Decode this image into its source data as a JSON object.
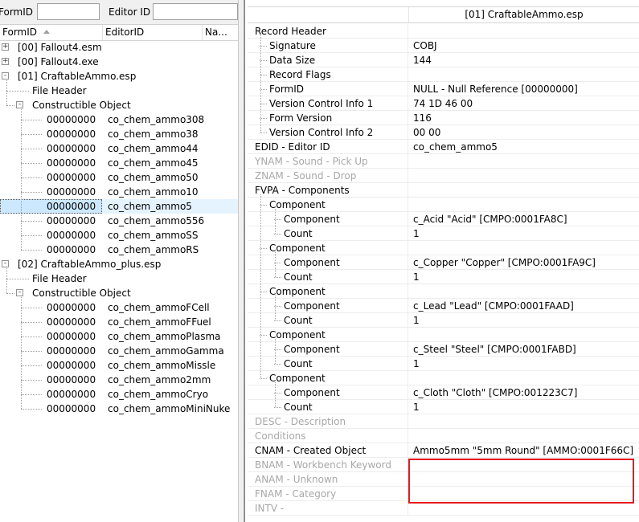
{
  "filters": {
    "formid_label": "FormID",
    "editorid_label": "Editor ID",
    "formid_value": "",
    "editorid_value": ""
  },
  "left_columns": {
    "formid": "FormID",
    "editorid": "EditorID",
    "name": "Na..."
  },
  "tree": [
    {
      "id": "t0",
      "level": 0,
      "expander": "+",
      "text": "[00] Fallout4.esm"
    },
    {
      "id": "t1",
      "level": 0,
      "expander": "+",
      "text": "[00] Fallout4.exe"
    },
    {
      "id": "t2",
      "level": 0,
      "expander": "-",
      "text": "[01] CraftableAmmo.esp"
    },
    {
      "id": "t3",
      "level": 1,
      "expander": "",
      "text": "File Header"
    },
    {
      "id": "t4",
      "level": 1,
      "expander": "-",
      "text": "Constructible Object"
    },
    {
      "id": "t5",
      "level": 2,
      "formid": "00000000",
      "editor": "co_chem_ammo308"
    },
    {
      "id": "t6",
      "level": 2,
      "formid": "00000000",
      "editor": "co_chem_ammo38"
    },
    {
      "id": "t7",
      "level": 2,
      "formid": "00000000",
      "editor": "co_chem_ammo44"
    },
    {
      "id": "t8",
      "level": 2,
      "formid": "00000000",
      "editor": "co_chem_ammo45"
    },
    {
      "id": "t9",
      "level": 2,
      "formid": "00000000",
      "editor": "co_chem_ammo50"
    },
    {
      "id": "t10",
      "level": 2,
      "formid": "00000000",
      "editor": "co_chem_ammo10"
    },
    {
      "id": "t11",
      "level": 2,
      "formid": "00000000",
      "editor": "co_chem_ammo5",
      "selected": true
    },
    {
      "id": "t12",
      "level": 2,
      "formid": "00000000",
      "editor": "co_chem_ammo556"
    },
    {
      "id": "t13",
      "level": 2,
      "formid": "00000000",
      "editor": "co_chem_ammoSS"
    },
    {
      "id": "t14",
      "level": 2,
      "formid": "00000000",
      "editor": "co_chem_ammoRS"
    },
    {
      "id": "t15",
      "level": 0,
      "expander": "-",
      "text": "[02] CraftableAmmo_plus.esp"
    },
    {
      "id": "t16",
      "level": 1,
      "expander": "",
      "text": "File Header"
    },
    {
      "id": "t17",
      "level": 1,
      "expander": "-",
      "text": "Constructible Object"
    },
    {
      "id": "t18",
      "level": 2,
      "formid": "00000000",
      "editor": "co_chem_ammoFCell"
    },
    {
      "id": "t19",
      "level": 2,
      "formid": "00000000",
      "editor": "co_chem_ammoFFuel"
    },
    {
      "id": "t20",
      "level": 2,
      "formid": "00000000",
      "editor": "co_chem_ammoPlasma"
    },
    {
      "id": "t21",
      "level": 2,
      "formid": "00000000",
      "editor": "co_chem_ammoGamma"
    },
    {
      "id": "t22",
      "level": 2,
      "formid": "00000000",
      "editor": "co_chem_ammoMissle"
    },
    {
      "id": "t23",
      "level": 2,
      "formid": "00000000",
      "editor": "co_chem_ammo2mm"
    },
    {
      "id": "t24",
      "level": 2,
      "formid": "00000000",
      "editor": "co_chem_ammoCryo"
    },
    {
      "id": "t25",
      "level": 2,
      "formid": "00000000",
      "editor": "co_chem_ammoMiniNuke"
    }
  ],
  "record_view": {
    "header_title": "[01] CraftableAmmo.esp",
    "rows": [
      {
        "label": "Record Header",
        "value": "",
        "level": 0,
        "grey": false
      },
      {
        "label": "Signature",
        "value": "COBJ",
        "level": 1,
        "grey": false
      },
      {
        "label": "Data Size",
        "value": "144",
        "level": 1,
        "grey": false
      },
      {
        "label": "Record Flags",
        "value": "",
        "level": 1,
        "grey": false
      },
      {
        "label": "FormID",
        "value": "NULL - Null Reference [00000000]",
        "level": 1,
        "grey": false
      },
      {
        "label": "Version Control Info 1",
        "value": "74 1D 46 00",
        "level": 1,
        "grey": false
      },
      {
        "label": "Form Version",
        "value": "116",
        "level": 1,
        "grey": false
      },
      {
        "label": "Version Control Info 2",
        "value": "00 00",
        "level": 1,
        "grey": false
      },
      {
        "label": "EDID - Editor ID",
        "value": "co_chem_ammo5",
        "level": 0,
        "grey": false
      },
      {
        "label": "YNAM - Sound - Pick Up",
        "value": "",
        "level": 0,
        "grey": true
      },
      {
        "label": "ZNAM - Sound - Drop",
        "value": "",
        "level": 0,
        "grey": true
      },
      {
        "label": "FVPA - Components",
        "value": "",
        "level": 0,
        "grey": false
      },
      {
        "label": "Component",
        "value": "",
        "level": 1,
        "grey": false
      },
      {
        "label": "Component",
        "value": "c_Acid \"Acid\" [CMPO:0001FA8C]",
        "level": 2,
        "grey": false
      },
      {
        "label": "Count",
        "value": "1",
        "level": 2,
        "grey": false
      },
      {
        "label": "Component",
        "value": "",
        "level": 1,
        "grey": false
      },
      {
        "label": "Component",
        "value": "c_Copper \"Copper\" [CMPO:0001FA9C]",
        "level": 2,
        "grey": false
      },
      {
        "label": "Count",
        "value": "1",
        "level": 2,
        "grey": false
      },
      {
        "label": "Component",
        "value": "",
        "level": 1,
        "grey": false
      },
      {
        "label": "Component",
        "value": "c_Lead \"Lead\" [CMPO:0001FAAD]",
        "level": 2,
        "grey": false
      },
      {
        "label": "Count",
        "value": "1",
        "level": 2,
        "grey": false
      },
      {
        "label": "Component",
        "value": "",
        "level": 1,
        "grey": false
      },
      {
        "label": "Component",
        "value": "c_Steel \"Steel\" [CMPO:0001FABD]",
        "level": 2,
        "grey": false
      },
      {
        "label": "Count",
        "value": "1",
        "level": 2,
        "grey": false
      },
      {
        "label": "Component",
        "value": "",
        "level": 1,
        "grey": false
      },
      {
        "label": "Component",
        "value": "c_Cloth \"Cloth\" [CMPO:001223C7]",
        "level": 2,
        "grey": false
      },
      {
        "label": "Count",
        "value": "1",
        "level": 2,
        "grey": false
      },
      {
        "label": "DESC - Description",
        "value": "",
        "level": 0,
        "grey": true
      },
      {
        "label": "Conditions",
        "value": "",
        "level": 0,
        "grey": true
      },
      {
        "label": "CNAM - Created Object",
        "value": "Ammo5mm \"5mm Round\" [AMMO:0001F66C]",
        "level": 0,
        "grey": false
      },
      {
        "label": "BNAM - Workbench Keyword",
        "value": "",
        "level": 0,
        "grey": true
      },
      {
        "label": "ANAM - Unknown",
        "value": "",
        "level": 0,
        "grey": true
      },
      {
        "label": "FNAM - Category",
        "value": "",
        "level": 0,
        "grey": true
      },
      {
        "label": "INTV -",
        "value": "",
        "level": 0,
        "grey": true
      }
    ]
  },
  "colors": {
    "selection": "#cce8ff",
    "highlight_box": "#e8181c",
    "disabled_text": "#a8a8a8"
  }
}
